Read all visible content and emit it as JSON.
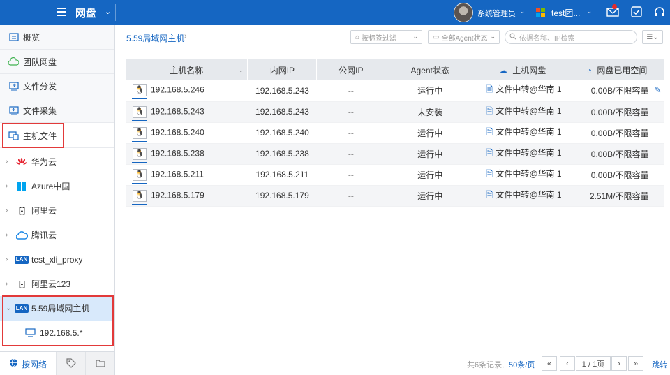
{
  "topbar": {
    "app_title": "网盘",
    "user_name": "系统管理员",
    "tenant_name": "test团..."
  },
  "sidebar": {
    "nav": [
      {
        "label": "概览",
        "icon": "overview-icon"
      },
      {
        "label": "团队网盘",
        "icon": "cloud-icon"
      },
      {
        "label": "文件分发",
        "icon": "distribute-icon"
      },
      {
        "label": "文件采集",
        "icon": "collect-icon"
      },
      {
        "label": "主机文件",
        "icon": "host-files-icon"
      }
    ],
    "tree": [
      {
        "label": "华为云",
        "icon": "huawei-icon"
      },
      {
        "label": "Azure中国",
        "icon": "azure-icon"
      },
      {
        "label": "阿里云",
        "icon": "aliyun-icon"
      },
      {
        "label": "腾讯云",
        "icon": "tencent-icon"
      },
      {
        "label": "test_xli_proxy",
        "icon": "lan-icon"
      },
      {
        "label": "阿里云123",
        "icon": "aliyun-icon"
      },
      {
        "label": "5.59局域网主机",
        "icon": "lan-icon"
      },
      {
        "label": "192.168.5.*",
        "icon": "monitor-icon"
      }
    ],
    "lan_badge": "LAN",
    "bottom_tabs": {
      "network": "按网络"
    }
  },
  "main": {
    "breadcrumb": "5.59局域网主机",
    "filters": {
      "tag": "按标签过滤",
      "agent": "全部Agent状态"
    },
    "search_placeholder": "依据名称、IP检索",
    "columns": [
      "主机名称",
      "内网IP",
      "公网IP",
      "Agent状态",
      "主机网盘",
      "网盘已用空间"
    ],
    "rows": [
      {
        "host": "192.168.5.246",
        "ip": "192.168.5.243",
        "pub": "--",
        "status": "运行中",
        "disk": "文件中转@华南 1",
        "used": "0.00B/不限容量"
      },
      {
        "host": "192.168.5.243",
        "ip": "192.168.5.243",
        "pub": "--",
        "status": "未安装",
        "disk": "文件中转@华南 1",
        "used": "0.00B/不限容量"
      },
      {
        "host": "192.168.5.240",
        "ip": "192.168.5.240",
        "pub": "--",
        "status": "运行中",
        "disk": "文件中转@华南 1",
        "used": "0.00B/不限容量"
      },
      {
        "host": "192.168.5.238",
        "ip": "192.168.5.238",
        "pub": "--",
        "status": "运行中",
        "disk": "文件中转@华南 1",
        "used": "0.00B/不限容量"
      },
      {
        "host": "192.168.5.211",
        "ip": "192.168.5.211",
        "pub": "--",
        "status": "运行中",
        "disk": "文件中转@华南 1",
        "used": "0.00B/不限容量"
      },
      {
        "host": "192.168.5.179",
        "ip": "192.168.5.179",
        "pub": "--",
        "status": "运行中",
        "disk": "文件中转@华南 1",
        "used": "2.51M/不限容量"
      }
    ],
    "pager": {
      "total": "共6条记录,",
      "per_page": "50条/页",
      "page": "1 / 1页",
      "jump": "跳转"
    }
  },
  "colors": {
    "brand": "#1566c2",
    "running": "#3fb24f",
    "highlight": "#e23a3a"
  }
}
